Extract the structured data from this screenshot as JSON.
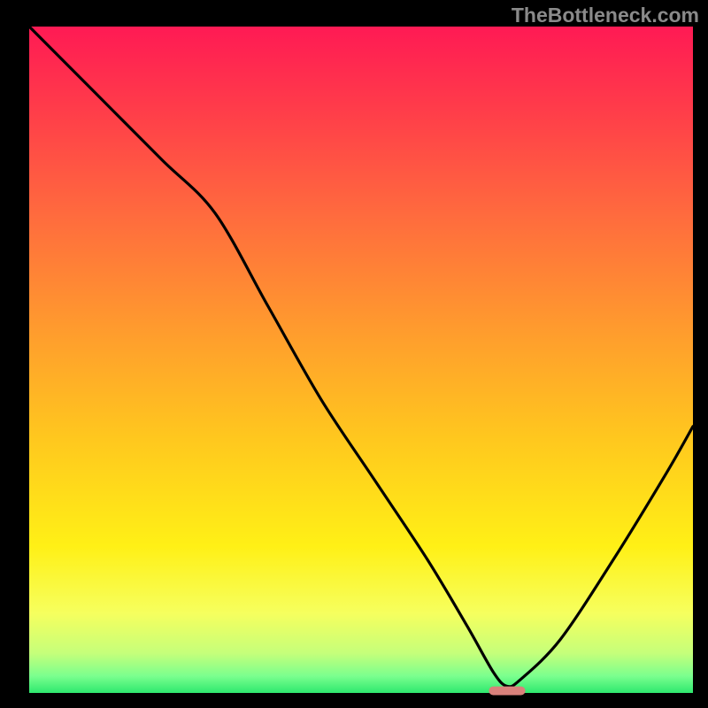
{
  "watermark": "TheBottleneck.com",
  "chart_data": {
    "type": "line",
    "title": "",
    "xlabel": "",
    "ylabel": "",
    "xlim": [
      0,
      100
    ],
    "ylim": [
      0,
      100
    ],
    "background": "vertical rainbow gradient (red top to green bottom) inside plot area, black outer frame",
    "series": [
      {
        "name": "bottleneck-curve",
        "description": "V-shaped curve starting at top-left, descending to a minimum near x≈72, then rising to right edge",
        "x": [
          0,
          10,
          20,
          28,
          36,
          44,
          52,
          60,
          66,
          70,
          72,
          74,
          80,
          88,
          96,
          100
        ],
        "values": [
          100,
          90,
          80,
          72,
          58,
          44,
          32,
          20,
          10,
          3,
          1,
          2,
          8,
          20,
          33,
          40
        ]
      }
    ],
    "annotations": [
      {
        "name": "optimal-marker",
        "type": "marker",
        "shape": "rounded-rect",
        "x_center": 72,
        "y_value": 0,
        "color": "#d9817b",
        "width_pct": 5.5,
        "height_pct": 1.3
      }
    ],
    "colors": {
      "frame": "#000000",
      "curve": "#000000",
      "gradient_stops": [
        {
          "offset": 0.0,
          "color": "#ff1a54"
        },
        {
          "offset": 0.12,
          "color": "#ff3b4a"
        },
        {
          "offset": 0.28,
          "color": "#ff6a3e"
        },
        {
          "offset": 0.45,
          "color": "#ff9a2e"
        },
        {
          "offset": 0.62,
          "color": "#ffc81e"
        },
        {
          "offset": 0.78,
          "color": "#fff016"
        },
        {
          "offset": 0.88,
          "color": "#f6ff5e"
        },
        {
          "offset": 0.94,
          "color": "#c6ff7a"
        },
        {
          "offset": 0.975,
          "color": "#7aff8e"
        },
        {
          "offset": 1.0,
          "color": "#2ee86e"
        }
      ]
    }
  }
}
